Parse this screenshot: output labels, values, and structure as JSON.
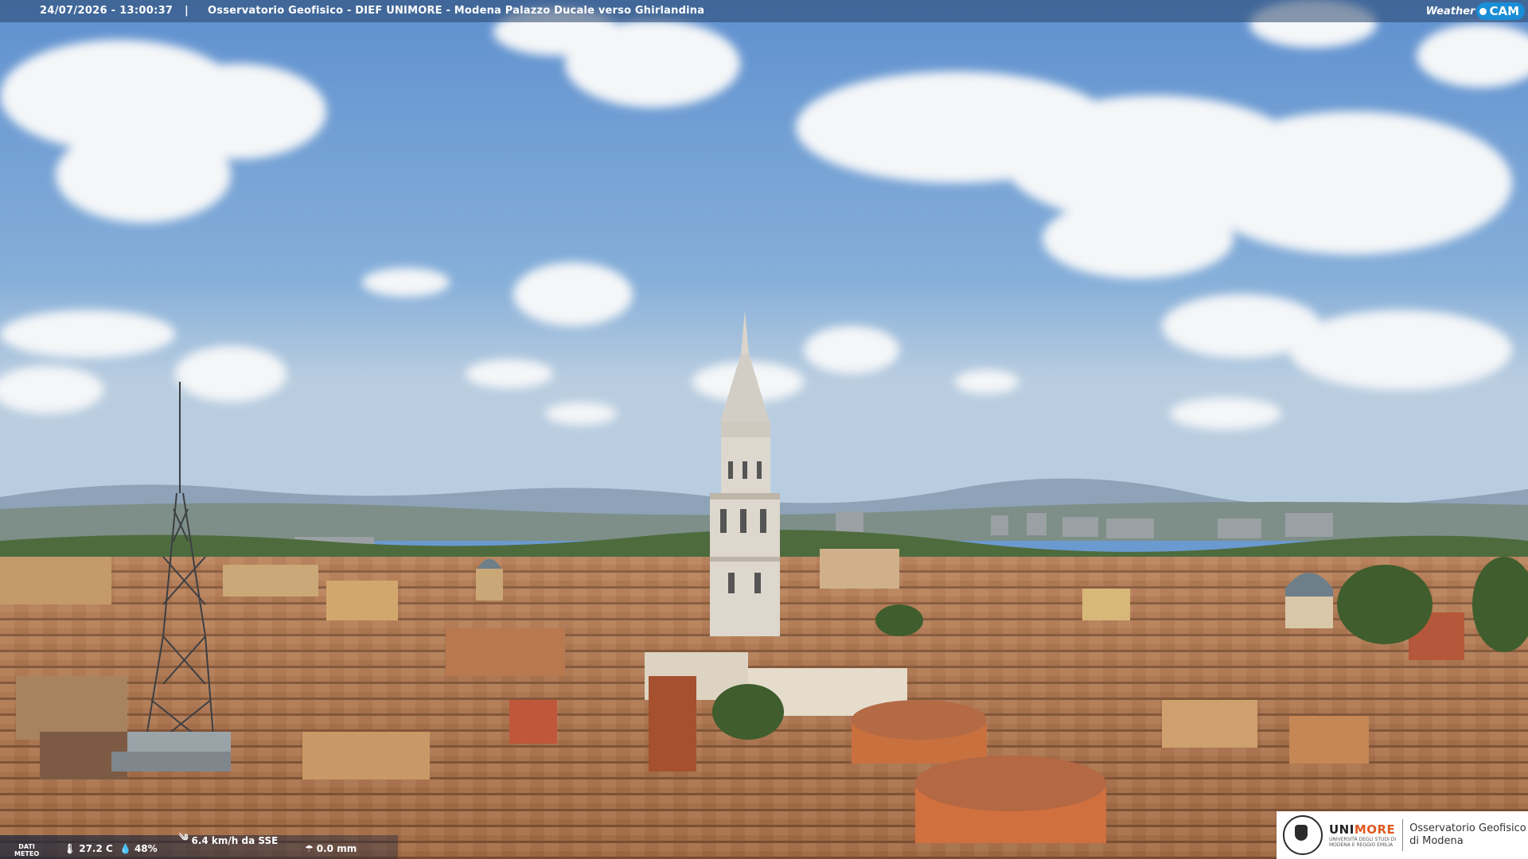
{
  "header": {
    "datetime": "24/07/2026 - 13:00:37",
    "separator": "|",
    "caption": "Osservatorio Geofisico - DIEF UNIMORE - Modena Palazzo Ducale verso Ghirlandina"
  },
  "brand": {
    "weather": "Weather",
    "cam": "CAM",
    "accent": "#1a8ed6"
  },
  "meteo": {
    "label_line1": "DATI",
    "label_line2": "METEO",
    "temperature": "27.2 C",
    "humidity": "48%",
    "wind": "6.4 km/h da SSE",
    "rain": "0.0 mm",
    "icons": [
      "thermometer-icon",
      "humidity-icon",
      "wind-icon",
      "rain-icon"
    ]
  },
  "logo": {
    "uni": "UNI",
    "more": "MORE",
    "uni_sub_line1": "UNIVERSITÀ DEGLI STUDI DI",
    "uni_sub_line2": "MODENA E REGGIO EMILIA",
    "observatory_line1": "Osservatorio Geofisico",
    "observatory_line2": "di Modena",
    "more_color": "#e05a1f"
  }
}
